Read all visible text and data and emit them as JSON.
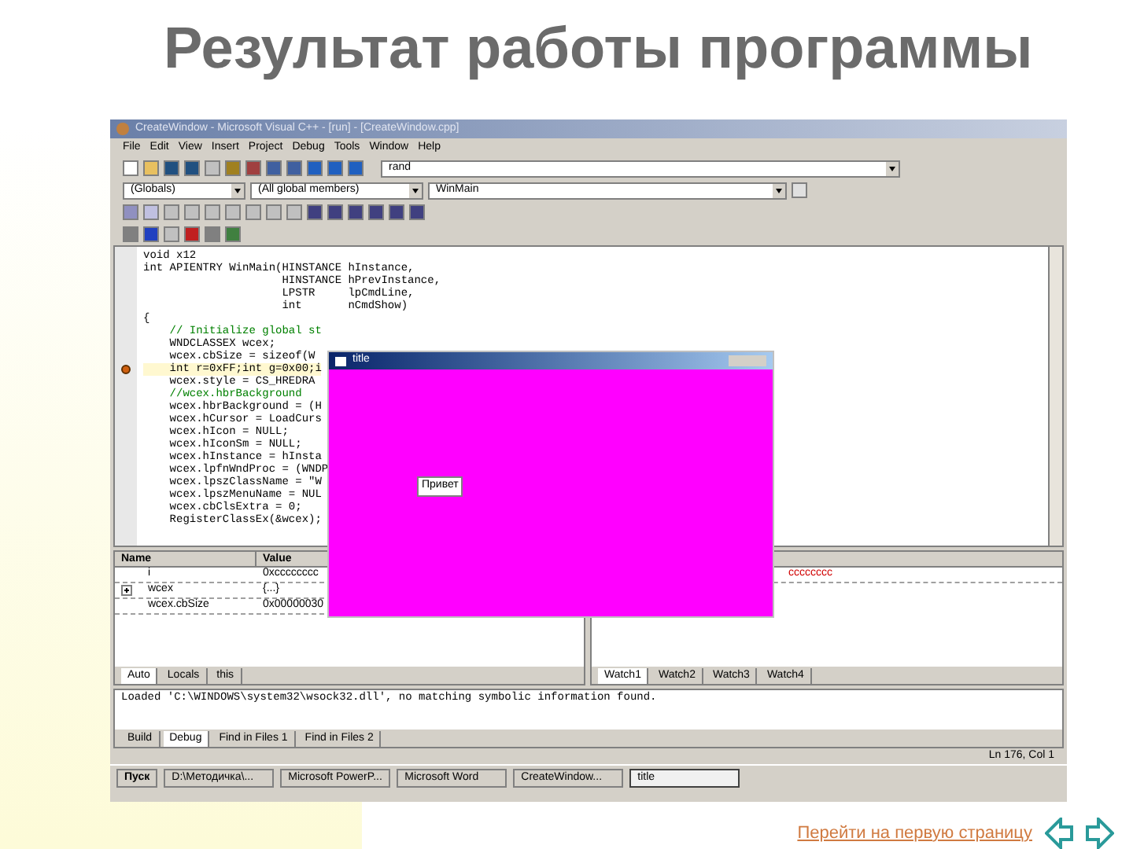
{
  "slide_title": "Результат работы программы",
  "app": {
    "title": "CreateWindow - Microsoft Visual C++ - [run] - [CreateWindow.cpp]",
    "menu": [
      "File",
      "Edit",
      "View",
      "Insert",
      "Project",
      "Debug",
      "Tools",
      "Window",
      "Help"
    ],
    "find_combo": "rand",
    "class_combo": "(Globals)",
    "members_combo": "(All global members)",
    "function_combo": "WinMain",
    "code": [
      {
        "kind": "code",
        "text": "void x12",
        "current": false
      },
      {
        "kind": "code",
        "text": "int APIENTRY WinMain(HINSTANCE hInstance,",
        "current": false
      },
      {
        "kind": "code",
        "text": "                     HINSTANCE hPrevInstance,",
        "current": false
      },
      {
        "kind": "code",
        "text": "                     LPSTR     lpCmdLine,",
        "current": false
      },
      {
        "kind": "code",
        "text": "                     int       nCmdShow)",
        "current": false
      },
      {
        "kind": "code",
        "text": "{",
        "current": false
      },
      {
        "kind": "comment",
        "text": "    // Initialize global st",
        "current": false
      },
      {
        "kind": "code",
        "text": "    WNDCLASSEX wcex;",
        "current": false
      },
      {
        "kind": "code",
        "text": "    wcex.cbSize = sizeof(W",
        "current": false
      },
      {
        "kind": "code",
        "text": "    int r=0xFF;int g=0x00;i",
        "current": true
      },
      {
        "kind": "code",
        "text": "    wcex.style = CS_HREDRA",
        "current": false
      },
      {
        "kind": "comment",
        "text": "    //wcex.hbrBackground",
        "current": false
      },
      {
        "kind": "code",
        "text": "    wcex.hbrBackground = (H",
        "current": false
      },
      {
        "kind": "code",
        "text": "    wcex.hCursor = LoadCurs",
        "current": false
      },
      {
        "kind": "code",
        "text": "    wcex.hIcon = NULL;",
        "current": false
      },
      {
        "kind": "code",
        "text": "    wcex.hIconSm = NULL;",
        "current": false
      },
      {
        "kind": "code",
        "text": "    wcex.hInstance = hInsta",
        "current": false
      },
      {
        "kind": "code",
        "text": "    wcex.lpfnWndProc = (WNDP",
        "current": false
      },
      {
        "kind": "code",
        "text": "    wcex.lpszClassName = \"W",
        "current": false
      },
      {
        "kind": "code",
        "text": "    wcex.lpszMenuName = NUL",
        "current": false
      },
      {
        "kind": "code",
        "text": "    wcex.cbClsExtra = 0;",
        "current": false
      },
      {
        "kind": "code",
        "text": "    RegisterClassEx(&wcex);",
        "current": false
      }
    ],
    "variables": {
      "columns": [
        "Name",
        "Value"
      ],
      "rows": [
        {
          "name": "i",
          "value": "0xcccccccc",
          "expandable": false
        },
        {
          "name": "wcex",
          "value": "{...}",
          "expandable": true
        },
        {
          "name": "wcex.cbSize",
          "value": "0x00000030",
          "expandable": false
        }
      ],
      "tabs": [
        {
          "label": "Auto",
          "selected": true
        },
        {
          "label": "Locals",
          "selected": false
        },
        {
          "label": "this",
          "selected": false
        }
      ]
    },
    "watch": {
      "value": "cccccccc",
      "tabs": [
        {
          "label": "Watch1",
          "selected": true
        },
        {
          "label": "Watch2",
          "selected": false
        },
        {
          "label": "Watch3",
          "selected": false
        },
        {
          "label": "Watch4",
          "selected": false
        }
      ]
    },
    "output": {
      "text": "Loaded 'C:\\WINDOWS\\system32\\wsock32.dll', no matching symbolic information found.",
      "tabs": [
        {
          "label": "Build",
          "selected": false
        },
        {
          "label": "Debug",
          "selected": true
        },
        {
          "label": "Find in Files 1",
          "selected": false
        },
        {
          "label": "Find in Files 2",
          "selected": false
        }
      ]
    },
    "status": "Ln 176, Col 1",
    "taskbar": {
      "start": "Пуск",
      "tasks": [
        {
          "label": "D:\\Методичка\\...",
          "selected": false
        },
        {
          "label": "Microsoft PowerP...",
          "selected": false
        },
        {
          "label": "Microsoft Word",
          "selected": false
        },
        {
          "label": "CreateWindow...",
          "selected": false
        },
        {
          "label": "title",
          "selected": true
        }
      ]
    },
    "popup": {
      "title": "title",
      "button": "Привет"
    }
  },
  "nav": {
    "link": "Перейти на первую страницу"
  }
}
